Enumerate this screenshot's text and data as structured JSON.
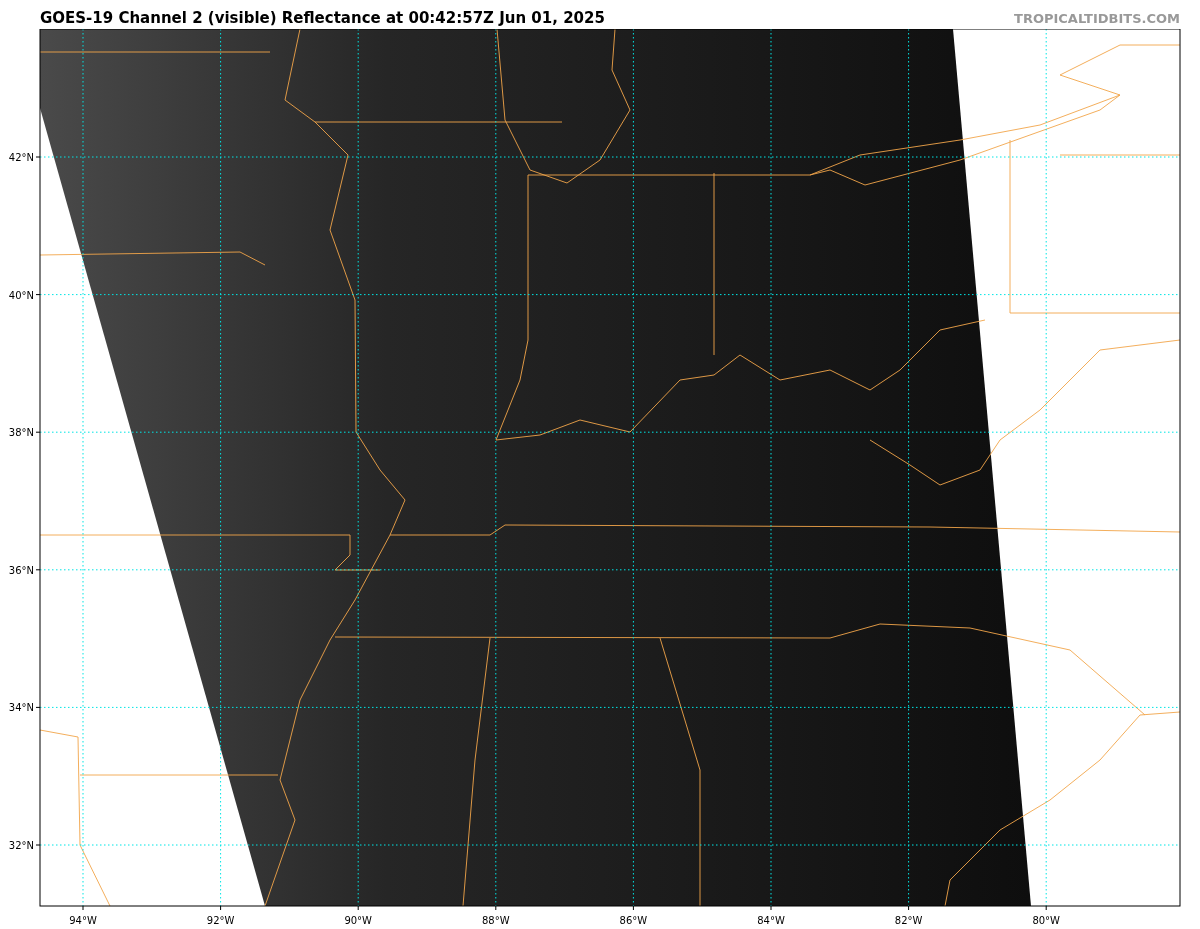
{
  "title": "GOES-19 Channel 2 (visible) Reflectance at 00:42:57Z Jun 01, 2025",
  "source": "TROPICALTIDBITS.COM",
  "map": {
    "latitude_labels": [
      "42°N",
      "40°N",
      "38°N",
      "36°N",
      "34°N",
      "32°N"
    ],
    "longitude_labels": [
      "94°W",
      "92°W",
      "90°W",
      "88°W",
      "86°W",
      "84°W",
      "82°W",
      "80°W"
    ]
  }
}
